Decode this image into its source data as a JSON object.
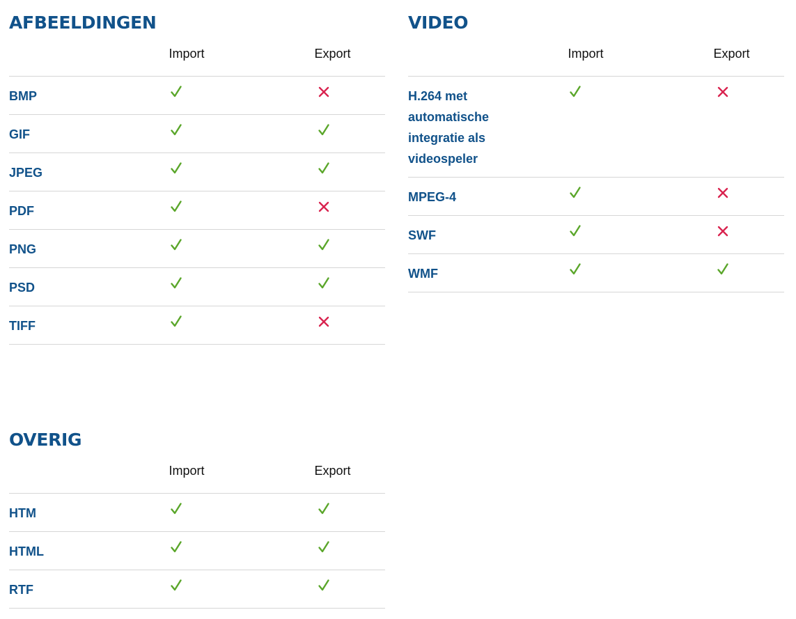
{
  "colors": {
    "title": "#11528a",
    "yes": "#5aa62a",
    "no": "#d9234f"
  },
  "columns": {
    "import": "Import",
    "export": "Export"
  },
  "sections": [
    {
      "key": "afbeeldingen",
      "title": "AFBEELDINGEN",
      "rows": [
        {
          "name": "BMP",
          "import": "check-icon",
          "export": "cross-icon"
        },
        {
          "name": "GIF",
          "import": "check-icon",
          "export": "check-icon"
        },
        {
          "name": "JPEG",
          "import": "check-icon",
          "export": "check-icon"
        },
        {
          "name": "PDF",
          "import": "check-icon",
          "export": "cross-icon"
        },
        {
          "name": "PNG",
          "import": "check-icon",
          "export": "check-icon"
        },
        {
          "name": "PSD",
          "import": "check-icon",
          "export": "check-icon"
        },
        {
          "name": "TIFF",
          "import": "check-icon",
          "export": "cross-icon"
        }
      ]
    },
    {
      "key": "video",
      "title": "VIDEO",
      "rows": [
        {
          "name": "H.264 met automatische integratie als videospeler",
          "import": "check-icon",
          "export": "cross-icon"
        },
        {
          "name": "MPEG-4",
          "import": "check-icon",
          "export": "cross-icon"
        },
        {
          "name": "SWF",
          "import": "check-icon",
          "export": "cross-icon"
        },
        {
          "name": "WMF",
          "import": "check-icon",
          "export": "check-icon"
        }
      ]
    },
    {
      "key": "overig",
      "title": "OVERIG",
      "rows": [
        {
          "name": "HTM",
          "import": "check-icon",
          "export": "check-icon"
        },
        {
          "name": "HTML",
          "import": "check-icon",
          "export": "check-icon"
        },
        {
          "name": "RTF",
          "import": "check-icon",
          "export": "check-icon"
        }
      ]
    }
  ]
}
